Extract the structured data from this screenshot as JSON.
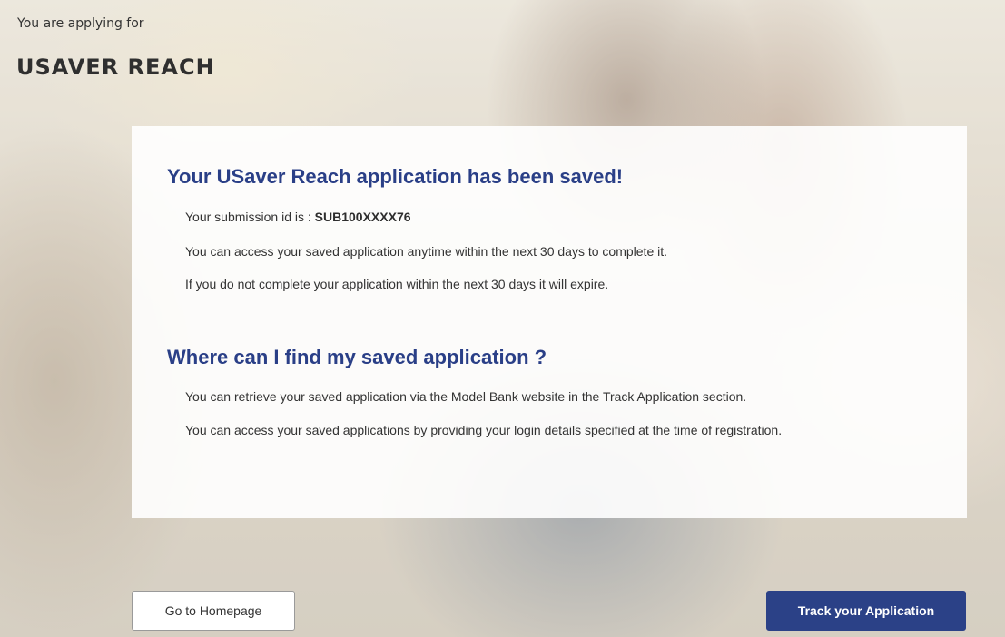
{
  "header": {
    "applying_label": "You are applying for",
    "product_name": "USAVER REACH"
  },
  "card": {
    "saved_heading": "Your USaver Reach application has been saved!",
    "submission_prefix": "Your submission id is : ",
    "submission_id": "SUB100XXXX76",
    "access_note": "You can access your saved application anytime within the next 30 days to complete it.",
    "expire_note": "If you do not complete your application within the next 30 days it will expire.",
    "where_heading": "Where can I find my saved application ?",
    "retrieve_note": "You can retrieve your saved application via the Model Bank website in the Track Application section.",
    "login_note": "You can access your saved applications by providing your login details specified at the time of registration."
  },
  "actions": {
    "home_label": "Go to Homepage",
    "track_label": "Track your Application"
  },
  "colors": {
    "heading": "#2a3f87",
    "primary_button": "#2b4187"
  }
}
